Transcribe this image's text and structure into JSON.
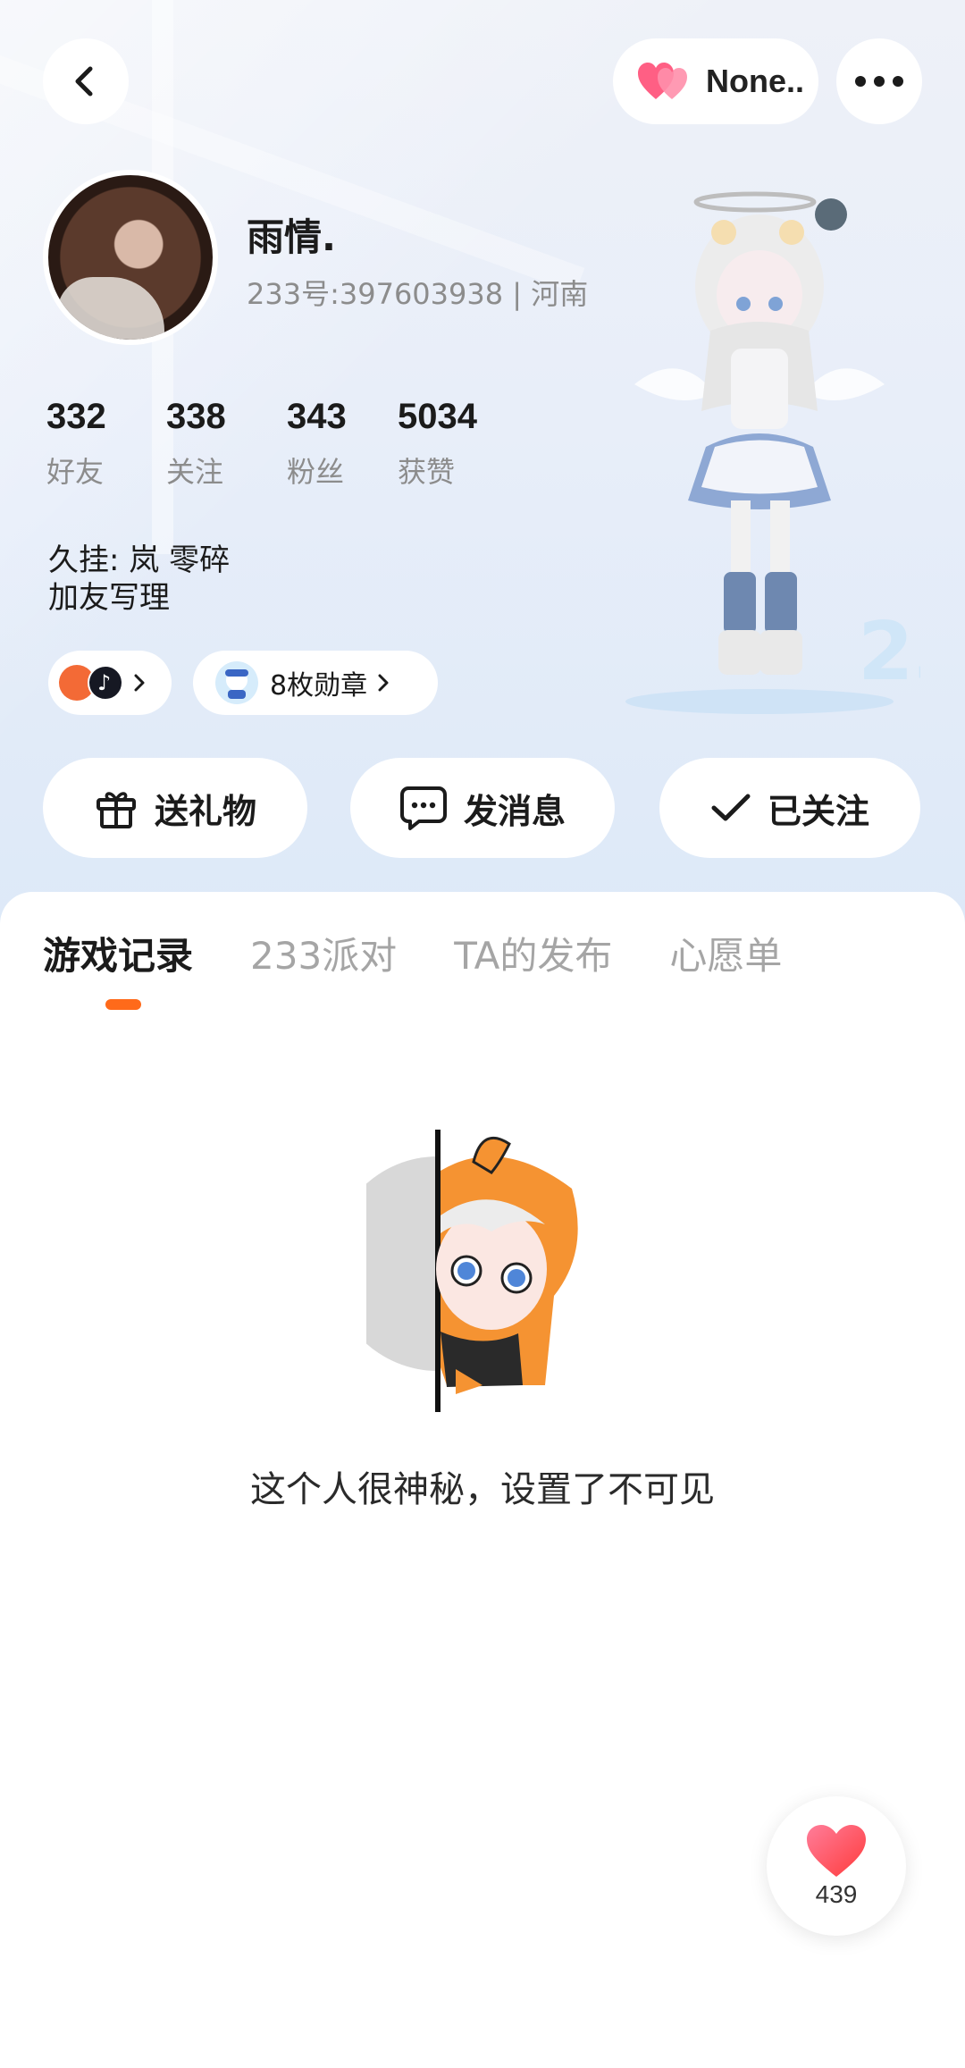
{
  "header": {
    "status_pill_label": "None..",
    "username": "雨情.",
    "user_id_line": "233号:397603938 | 河南"
  },
  "stats": [
    {
      "value": "332",
      "label": "好友"
    },
    {
      "value": "338",
      "label": "关注"
    },
    {
      "value": "343",
      "label": "粉丝"
    },
    {
      "value": "5034",
      "label": "获赞"
    }
  ],
  "bio": {
    "line1": "久挂:  岚  零碎",
    "line2": "加友写理"
  },
  "medals": {
    "label": "8枚勋章"
  },
  "actions": {
    "gift": "送礼物",
    "message": "发消息",
    "follow": "已关注"
  },
  "tabs": [
    {
      "label": "游戏记录",
      "active": true
    },
    {
      "label": "233派对",
      "active": false
    },
    {
      "label": "TA的发布",
      "active": false
    },
    {
      "label": "心愿单",
      "active": false
    }
  ],
  "empty_state": {
    "text": "这个人很神秘，设置了不可见"
  },
  "like": {
    "count": "439"
  },
  "colors": {
    "accent_orange": "#ff6a1a",
    "heart_red": "#ff4d5e",
    "heart_pink": "#ff7d9a"
  },
  "icons": [
    "back-icon",
    "heart-icon",
    "more-icon",
    "gift-icon",
    "message-icon",
    "check-icon",
    "chevron-right-icon"
  ]
}
